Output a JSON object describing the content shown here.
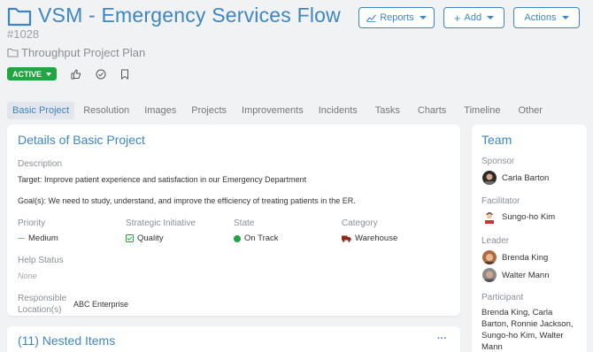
{
  "header": {
    "title": "VSM - Emergency Services Flow",
    "id": "#1028",
    "plan": "Throughput Project Plan",
    "status": "ACTIVE",
    "buttons": {
      "reports": "Reports",
      "add": "Add",
      "actions": "Actions"
    }
  },
  "tabs": [
    "Basic Project",
    "Resolution",
    "Images",
    "Projects",
    "Improvements",
    "Incidents",
    "Tasks",
    "Charts",
    "Timeline",
    "Other"
  ],
  "details": {
    "title": "Details of Basic Project",
    "description_label": "Description",
    "target": "Target: Improve patient experience and satisfaction in our Emergency Department",
    "goals": "Goal(s): We need to study, understand, and improve the efficiency of treating patients in the ER.",
    "priority_label": "Priority",
    "priority_value": "Medium",
    "strategic_label": "Strategic Initiative",
    "strategic_value": "Quality",
    "state_label": "State",
    "state_value": "On Track",
    "category_label": "Category",
    "category_value": "Warehouse",
    "help_label": "Help Status",
    "help_value": "None",
    "responsible_label_1": "Responsible",
    "responsible_label_2": "Location(s)",
    "responsible_value": "ABC Enterprise"
  },
  "nested": {
    "title": "(11) Nested Items",
    "more": "···"
  },
  "team": {
    "title": "Team",
    "sponsor_label": "Sponsor",
    "sponsor": "Carla Barton",
    "facilitator_label": "Facilitator",
    "facilitator": "Sungo-ho Kim",
    "leader_label": "Leader",
    "leaders": [
      "Brenda King",
      "Walter Mann"
    ],
    "participant_label": "Participant",
    "participants_lines": [
      "Brenda King, Carla",
      "Barton, Ronnie Jackson,",
      "Sungo-ho Kim, Walter",
      "Mann"
    ]
  },
  "colors": {
    "accent": "#3d86c6",
    "active": "#23a440",
    "on_track": "#23a440",
    "priority": "#f0a030",
    "category": "#8a2a1a"
  },
  "icons": [
    "folder-icon",
    "like-icon",
    "check-circle-icon",
    "bookmark-icon",
    "chart-icon",
    "plus-icon",
    "truck-icon",
    "checkbox-icon"
  ]
}
